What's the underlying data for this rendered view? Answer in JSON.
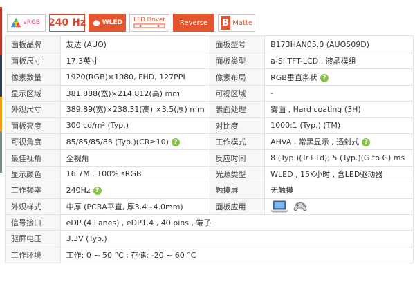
{
  "badges": {
    "srgb": "sRGB",
    "refresh": "240 Hz",
    "wled": "WLED",
    "led_driver": "LED Driver",
    "reverse": "Reverse",
    "matte_letter": "B",
    "matte": "Matte"
  },
  "help_symbol": "?",
  "specs": [
    [
      {
        "label": "面板品牌",
        "value": "友达 (AUO)"
      },
      {
        "label": "面板型号",
        "value": "B173HAN05.0 (AUO509D)"
      }
    ],
    [
      {
        "label": "面板尺寸",
        "value": "17.3英寸"
      },
      {
        "label": "面板类型",
        "value": "a-Si TFT-LCD , 液晶模组"
      }
    ],
    [
      {
        "label": "像素数量",
        "value": "1920(RGB)×1080, FHD, 127PPI"
      },
      {
        "label": "像素布局",
        "value": "RGB垂直条状",
        "help": true
      }
    ],
    [
      {
        "label": "显示区域",
        "value": "381.888(宽)×214.812(高) mm"
      },
      {
        "label": "可视区域",
        "value": "-"
      }
    ],
    [
      {
        "label": "外观尺寸",
        "value": "389.89(宽)×238.31(高) ×3.5(厚) mm"
      },
      {
        "label": "表面处理",
        "value": "雾面 , Hard coating (3H)"
      }
    ],
    [
      {
        "label": "面板亮度",
        "value": "300 cd/m² (Typ.)"
      },
      {
        "label": "对比度",
        "value": "1000:1 (Typ.) (TM)"
      }
    ],
    [
      {
        "label": "可视角度",
        "value": "85/85/85/85 (Typ.)(CR≥10)",
        "help": true
      },
      {
        "label": "工作模式",
        "value": "AHVA , 常黑显示 , 透射式",
        "help": true
      }
    ],
    [
      {
        "label": "最佳视角",
        "value": "全视角"
      },
      {
        "label": "反应时间",
        "value": "8 (Typ.)(Tr+Td); 5 (Typ.)(G to G) ms"
      }
    ],
    [
      {
        "label": "显示颜色",
        "value": "16.7M , 100% sRGB"
      },
      {
        "label": "光源类型",
        "value": "WLED , 15K小时 , 含LED驱动器"
      }
    ],
    [
      {
        "label": "工作频率",
        "value": "240Hz",
        "help": true
      },
      {
        "label": "触摸屏",
        "value": "无触摸"
      }
    ],
    [
      {
        "label": "外观样式",
        "value": "中厚 (PCBA平直, 厚3.4~4.0mm)"
      },
      {
        "label": "面板应用",
        "icons": [
          "laptop-icon",
          "gamepad-icon"
        ]
      }
    ],
    [
      {
        "label": "信号接口",
        "value": "eDP (4 Lanes) , eDP1.4 , 40 pins , 端子"
      }
    ],
    [
      {
        "label": "驱屏电压",
        "value": "3.3V (Typ.)"
      }
    ],
    [
      {
        "label": "工作环境",
        "value": "工作: 0 ~ 50 °C ; 存储: -20 ~ 60 °C"
      }
    ]
  ]
}
